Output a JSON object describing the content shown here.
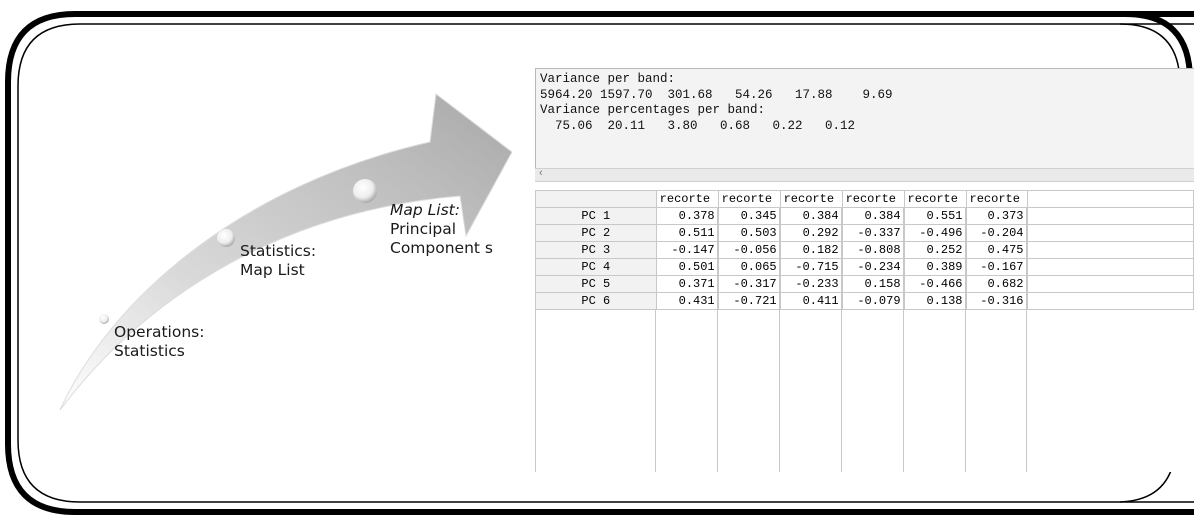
{
  "workflow": {
    "steps": [
      {
        "lines": [
          "Operations:",
          "Statistics"
        ]
      },
      {
        "lines": [
          "Statistics:",
          "Map List"
        ]
      },
      {
        "title": "Map List:",
        "lines": [
          "Principal",
          "Component s"
        ]
      }
    ]
  },
  "output": {
    "lines": [
      "Variance per band:",
      "5964.20 1597.70  301.68   54.26   17.88    9.69",
      "Variance percentages per band:",
      "  75.06  20.11   3.80   0.68   0.22   0.12"
    ],
    "scroll_arrow": "‹"
  },
  "table": {
    "columns": [
      "recorte",
      "recorte",
      "recorte",
      "recorte",
      "recorte",
      "recorte"
    ],
    "rows": [
      {
        "label": "PC 1",
        "values": [
          "0.378",
          "0.345",
          "0.384",
          "0.384",
          "0.551",
          "0.373"
        ]
      },
      {
        "label": "PC 2",
        "values": [
          "0.511",
          "0.503",
          "0.292",
          "-0.337",
          "-0.496",
          "-0.204"
        ]
      },
      {
        "label": "PC 3",
        "values": [
          "-0.147",
          "-0.056",
          "0.182",
          "-0.808",
          "0.252",
          "0.475"
        ]
      },
      {
        "label": "PC 4",
        "values": [
          "0.501",
          "0.065",
          "-0.715",
          "-0.234",
          "0.389",
          "-0.167"
        ]
      },
      {
        "label": "PC 5",
        "values": [
          "0.371",
          "-0.317",
          "-0.233",
          "0.158",
          "-0.466",
          "0.682"
        ]
      },
      {
        "label": "PC 6",
        "values": [
          "0.431",
          "-0.721",
          "0.411",
          "-0.079",
          "0.138",
          "-0.316"
        ]
      }
    ]
  }
}
